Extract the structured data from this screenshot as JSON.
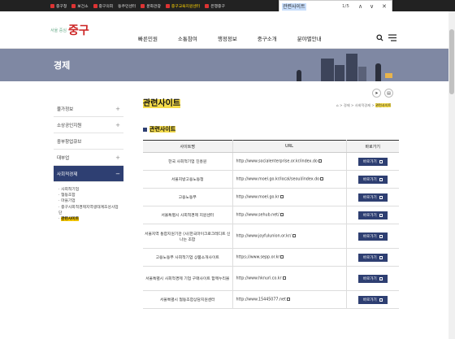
{
  "topbar": {
    "links": [
      "중구청",
      "보건소",
      "중구의회",
      "동주민센터",
      "문화관광",
      "중구교육지원센터",
      "은행중구"
    ]
  },
  "find": {
    "query": "관련사이트",
    "count": "1/5",
    "prev": "∧",
    "next": "∨",
    "close": "✕"
  },
  "header": {
    "logo_small": "서울 중심",
    "logo_big": "중구",
    "gnb": [
      "빠른민원",
      "소통참여",
      "행정정보",
      "중구소개",
      "분야별안내"
    ]
  },
  "banner": {
    "title": "경제"
  },
  "lnb": {
    "items": [
      "물가정보",
      "소상공인지원",
      "중부창업큐브",
      "대부업",
      "사회적경제"
    ],
    "sub": [
      "사회적기업",
      "협동조합",
      "마을기업",
      "중구사회적경제지역생태계조성사업단",
      "관련사이트"
    ]
  },
  "content": {
    "title": "관련사이트",
    "breadcrumb": [
      "홈",
      "경제",
      "사회적경제",
      "관련사이트"
    ],
    "section": "관련사이트",
    "columns": [
      "사이트명",
      "URL",
      "바로가기"
    ],
    "go_label": "바로가기",
    "rows": [
      {
        "name": "한국 사회적기업 진흥원",
        "url": "http://www.socialenterprise.or.kr/index.do"
      },
      {
        "name": "서울지방고용노동청",
        "url": "http://www.moel.go.kr/local/seoul/index.do"
      },
      {
        "name": "고용노동부",
        "url": "http://www.moel.go.kr"
      },
      {
        "name": "서울특별시 사회적경제 지원센터",
        "url": "http://www.sehub.net/"
      },
      {
        "name": "서울지역 통합지원기관 (사)한국마이크로크레디트 신나는 조합",
        "url": "http://www.joyfulunion.or.kr/"
      },
      {
        "name": "고용노동부 사회적기업 상품소개사이트",
        "url": "https://www.sepp.or.kr"
      },
      {
        "name": "서울특별시 사회적경제 기업 구매사이트 함께누리몰",
        "url": "http://www.hknuri.co.kr"
      },
      {
        "name": "서울특별시 협동조합상담지원센터",
        "url": "http://www.15445077.net"
      }
    ]
  }
}
